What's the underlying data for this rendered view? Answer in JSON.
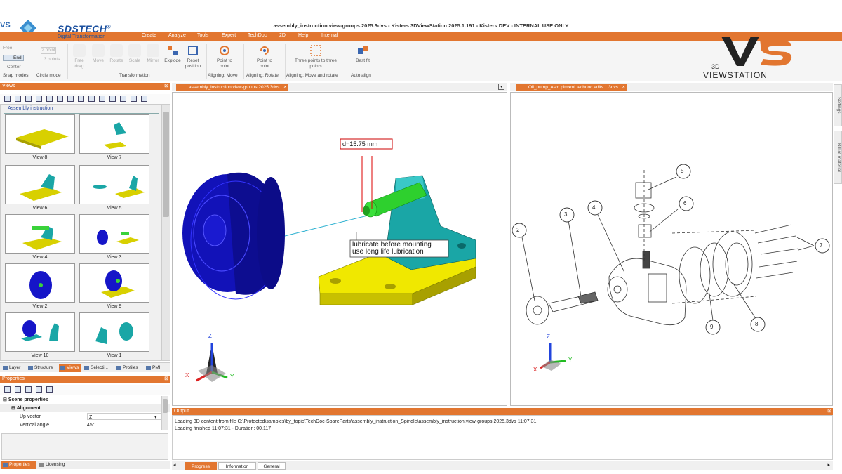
{
  "window": {
    "title": "assembly_instruction.view-groups.2025.3dvs - Kisters 3DViewStation 2025.1.191 - Kisters DEV - INTERNAL USE ONLY",
    "brand_tech": "SDSTECH",
    "brand_registered": "®",
    "brand_sub": "Digital Transformation",
    "vs_small": "VS",
    "vs_3d": "3D",
    "vs_word": "VIEWSTATION"
  },
  "menu": [
    "Create",
    "Analyze",
    "Tools",
    "Expert",
    "TechDoc",
    "2D",
    "Help",
    "Internal"
  ],
  "ribbon": {
    "snap": {
      "free": "Free",
      "end": "End",
      "center": "Center",
      "label": "Snap modes"
    },
    "circle": {
      "p1": "2 point",
      "p2": "3 points",
      "label": "Circle mode"
    },
    "transform": {
      "items": [
        "Free drag",
        "Move",
        "Rotate",
        "Scale",
        "Mirror",
        "Explode",
        "Reset position"
      ],
      "label": "Transformation"
    },
    "align_move": {
      "button": "Point to point",
      "label": "Aligning: Move"
    },
    "align_rotate": {
      "button": "Point to point",
      "label": "Aligning: Rotate"
    },
    "align_both": {
      "button": "Three points to three points",
      "label": "Aligning: Move and rotate"
    },
    "auto": {
      "button": "Best fit",
      "label": "Auto align"
    }
  },
  "views_panel": {
    "title": "Views",
    "group": "Assembly instruction",
    "thumbs": [
      "View 8",
      "View 7",
      "View 6",
      "View 5",
      "View 4",
      "View 3",
      "View 2",
      "View 9",
      "View 10",
      "View 1"
    ]
  },
  "bottom_tabs": [
    "Layer",
    "Structure",
    "Views",
    "Selecti...",
    "Profiles",
    "PMI"
  ],
  "properties": {
    "title": "Properties",
    "scene": "Scene properties",
    "alignment": "Alignment",
    "up_vector_label": "Up vector",
    "up_vector_value": "Z",
    "vertical_angle_label": "Vertical angle",
    "vertical_angle_value": "45°",
    "tab_properties": "Properties",
    "tab_licensing": "Licensing"
  },
  "doc_left": {
    "tab": "assembly_instruction.view-groups.2025.3dvs",
    "dimension": "d=15.75 mm",
    "note_line1": "lubricate before mounting",
    "note_line2": "use long life lubrication"
  },
  "doc_right": {
    "tab": "Oil_pump_Asm.plmxml.techdoc.edits.1.3dvs",
    "callouts": [
      "2",
      "3",
      "4",
      "5",
      "6",
      "7",
      "8",
      "9"
    ]
  },
  "axes": {
    "x": "X",
    "y": "Y",
    "z": "Z"
  },
  "side_tabs": [
    "Settings",
    "Bill of material"
  ],
  "output": {
    "title": "Output",
    "line1": "Loading 3D content from file C:\\Protected\\samples\\by_topic\\TechDoc-SpareParts\\assembly_instruction_Spindle\\assembly_instruction.view-groups.2025.3dvs 11:07:31",
    "line2": "Loading finished 11:07:31 - Duration: 00.117",
    "tabs": [
      "Progress",
      "Information",
      "General"
    ]
  },
  "colors": {
    "accent": "#e27630",
    "blue_part": "#1515c8",
    "yellow_part": "#e8e000",
    "cyan_part": "#1aa6a6",
    "green_part": "#3ad23a"
  }
}
